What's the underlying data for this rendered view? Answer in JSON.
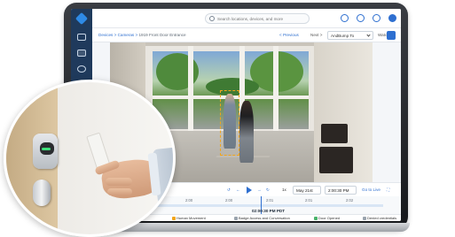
{
  "search": {
    "placeholder": "Search locations, devices, and more"
  },
  "breadcrumb": {
    "devices": "Devices",
    "cameras": "Cameras",
    "camera": "1919 Front Door Entrance"
  },
  "nav": {
    "previous": "< Previous",
    "next": "Next >",
    "sort": "AndBump To",
    "watch": "Watch"
  },
  "playback": {
    "speed": "1x",
    "date": "May 21st",
    "time": "2:00:30 PM",
    "go_live": "Go to Live",
    "current_time": "02:00:30 PM PDT",
    "ticks": [
      "2:00",
      "2:00",
      "2:00",
      "2:01",
      "2:01",
      "2:02"
    ]
  },
  "legend": [
    {
      "label": "Motion / Alert",
      "color": "#2e6fd0"
    },
    {
      "label": "Human Movement",
      "color": "#f2a51a"
    },
    {
      "label": "Badge Access and Conversation",
      "color": "#9aa4ae"
    },
    {
      "label": "Door Opened",
      "color": "#49b36b"
    },
    {
      "label": "Denied credentials",
      "color": "#9aa4ae"
    }
  ],
  "colors": {
    "sidebar": "#1f3a5c",
    "accent": "#2e6fd0",
    "detection": "#f2a51a",
    "reader_led": "#3ee07a"
  }
}
